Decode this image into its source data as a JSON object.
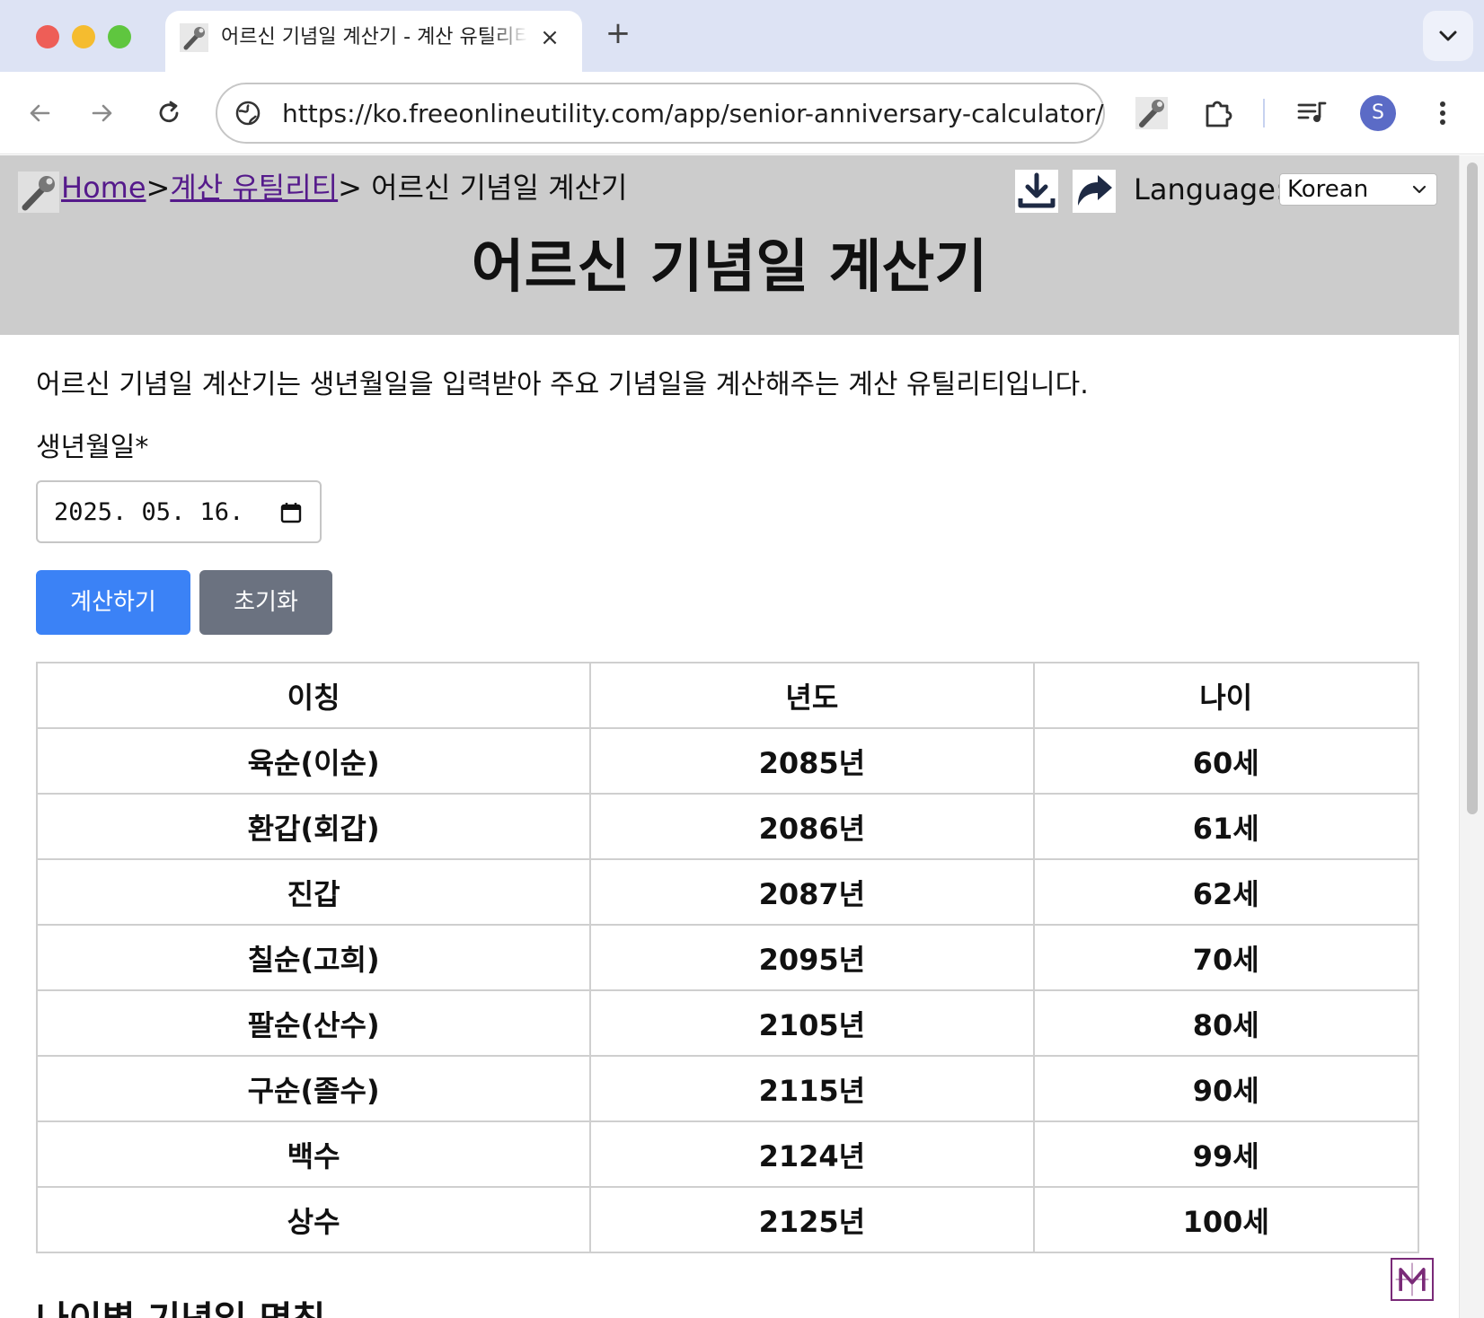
{
  "browser": {
    "tab_title": "어르신 기념일 계산기 - 계산 유틸리티",
    "tab_close": "×",
    "new_tab": "+",
    "url": "https://ko.freeonlineutility.com/app/senior-anniversary-calculator/",
    "avatar_letter": "S",
    "traffic_colors": {
      "close": "#ee5e57",
      "minimize": "#f5bc2f",
      "zoom": "#5fc63f"
    }
  },
  "header": {
    "breadcrumb": {
      "home": "Home",
      "separator": ">",
      "category": "계산 유틸리티",
      "current": "> 어르신 기념일 계산기"
    },
    "language_label": "Language:",
    "language_selected": "Korean",
    "title": "어르신 기념일 계산기"
  },
  "main": {
    "intro": "어르신 기념일 계산기는 생년월일을 입력받아 주요 기념일을 계산해주는 계산 유틸리티입니다.",
    "birth_label": "생년월일*",
    "birth_value": "2025. 05. 16.",
    "calc_button": "계산하기",
    "reset_button": "초기화",
    "table": {
      "headers": [
        "이칭",
        "년도",
        "나이"
      ],
      "rows": [
        [
          "육순(이순)",
          "2085년",
          "60세"
        ],
        [
          "환갑(회갑)",
          "2086년",
          "61세"
        ],
        [
          "진갑",
          "2087년",
          "62세"
        ],
        [
          "칠순(고희)",
          "2095년",
          "70세"
        ],
        [
          "팔순(산수)",
          "2105년",
          "80세"
        ],
        [
          "구순(졸수)",
          "2115년",
          "90세"
        ],
        [
          "백수",
          "2124년",
          "99세"
        ],
        [
          "상수",
          "2125년",
          "100세"
        ]
      ]
    },
    "next_heading": "나이별 기념일 명칭"
  },
  "colors": {
    "header_bg": "#cccccc",
    "primary_button": "#3b82f6",
    "secondary_button": "#6b7280",
    "link": "#551a8b"
  }
}
